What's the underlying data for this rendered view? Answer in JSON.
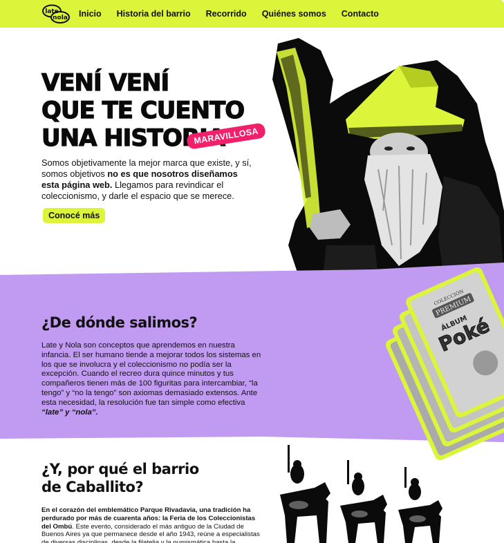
{
  "nav": {
    "logo_top": "late",
    "logo_bottom": "nola",
    "links": [
      "Inicio",
      "Historia del barrio",
      "Recorrido",
      "Quiénes somos",
      "Contacto"
    ]
  },
  "hero": {
    "title_lines": [
      "VENÍ VENÍ",
      "QUE TE CUENTO",
      "UNA HISTORIA"
    ],
    "badge": "MARAVILLOSA",
    "body_1": "Somos objetivamente la mejor marca que existe, y sí, somos objetivos ",
    "body_bold": "no es que nosotros diseñamos esta página web.",
    "body_2": " Llegamos para revindicar el coleccionismo, y darle el espacio que se merece.",
    "cta": "Conocé más"
  },
  "section_origin": {
    "title": "¿De dónde salimos?",
    "body_1": "Late y Nola son conceptos que aprendemos en nuestra infancia. El ser humano tiende a mejorar todos los sistemas en los que se involucra y el coleccionismo no podía ser la excepción. Cuando el recreo dura quince minutos y tus compañeros tienen más de 100 figuritas para intercambiar, “la tengo” y “no la tengo” son axiomas demasiado extensos. Ante esta necesidad, la resolución fue tan simple como efectiva ",
    "body_bold": "“late” y “nola”.",
    "card_label_1": "COLECCIÓN",
    "card_label_2": "PREMIUM",
    "card_album": "ÁLBUM",
    "card_brand": "Poké"
  },
  "section_barrio": {
    "title_line_1": "¿Y, por qué el barrio",
    "title_line_2": "de Caballito?",
    "body_bold": "En el corazón del emblemático Parque Rivadavia, una tradición ha perdurado por más de cuarenta años: la Feria de los Coleccionistas del Ombú",
    "body_1": ". Este evento, considerado el más antiguo de la Ciudad de Buenos Aires ya que permanece desde el año 1943, reúne a especialistas de diversas disciplinas, desde la filatelia y la numismática hasta la"
  },
  "colors": {
    "accent": "#dcf53a",
    "purple": "#c19bf2",
    "pink": "#f0206a",
    "ink": "#111111"
  }
}
